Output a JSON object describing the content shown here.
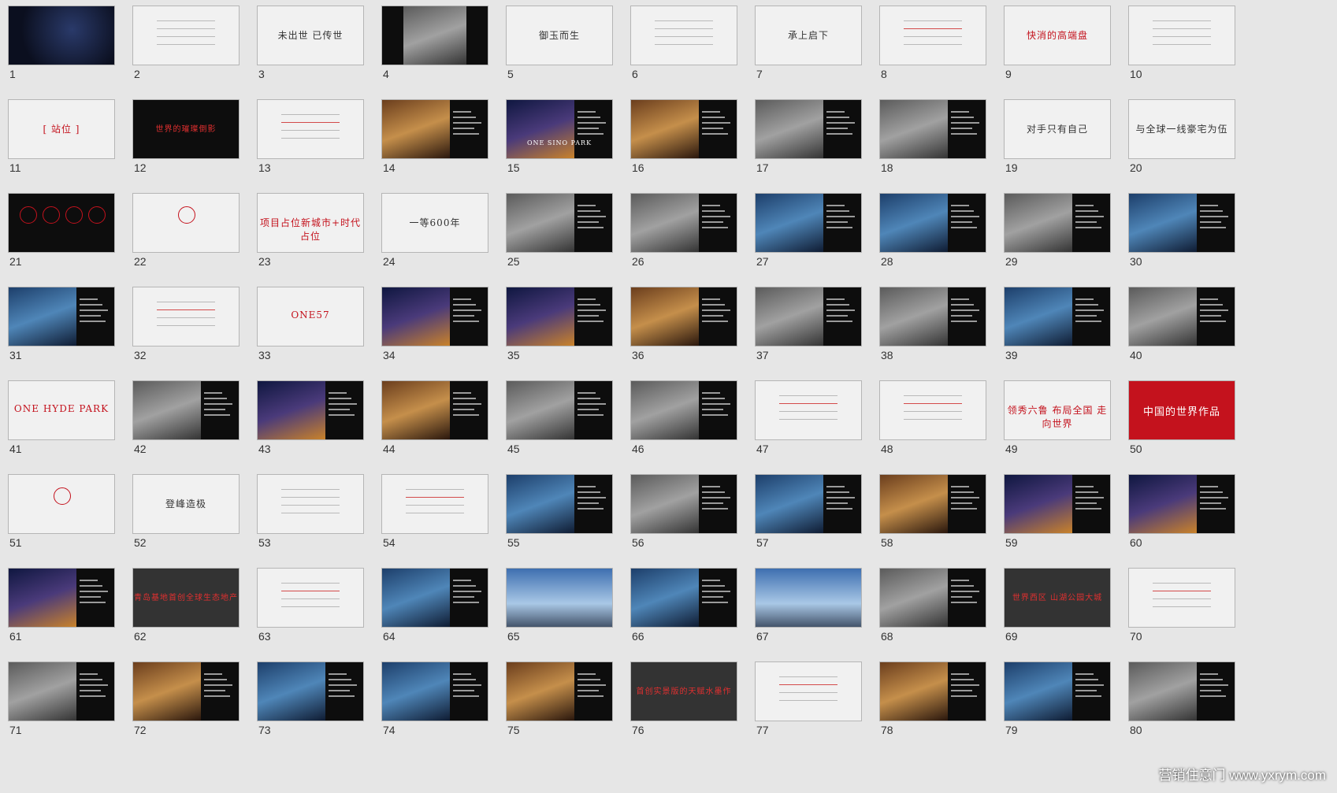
{
  "slides": [
    {
      "n": "1",
      "style": "dark",
      "caption": "",
      "visual": "space"
    },
    {
      "n": "2",
      "style": "light",
      "caption": "",
      "visual": "text"
    },
    {
      "n": "3",
      "style": "light",
      "caption": "未出世 已传世",
      "visual": "title"
    },
    {
      "n": "4",
      "style": "dark",
      "caption": "",
      "visual": "center-photo"
    },
    {
      "n": "5",
      "style": "light",
      "caption": "御玉而生",
      "visual": "title"
    },
    {
      "n": "6",
      "style": "light",
      "caption": "",
      "visual": "text"
    },
    {
      "n": "7",
      "style": "light",
      "caption": "承上启下",
      "visual": "title"
    },
    {
      "n": "8",
      "style": "light",
      "caption": "",
      "visual": "text-accent"
    },
    {
      "n": "9",
      "style": "light",
      "caption": "快消的高端盘",
      "visual": "title-accent"
    },
    {
      "n": "10",
      "style": "light",
      "caption": "",
      "visual": "text"
    },
    {
      "n": "11",
      "style": "light",
      "caption": "[ 站位 ]",
      "visual": "title-accent"
    },
    {
      "n": "12",
      "style": "dark",
      "caption": "世界的璀璨倒影",
      "visual": "title"
    },
    {
      "n": "13",
      "style": "light",
      "caption": "",
      "visual": "text-accent"
    },
    {
      "n": "14",
      "style": "dark",
      "caption": "",
      "visual": "photo-warm"
    },
    {
      "n": "15",
      "style": "dark",
      "caption": "ONE SINO PARK",
      "visual": "photo-night"
    },
    {
      "n": "16",
      "style": "dark",
      "caption": "",
      "visual": "photo-warm"
    },
    {
      "n": "17",
      "style": "dark",
      "caption": "",
      "visual": "photo-gray"
    },
    {
      "n": "18",
      "style": "dark",
      "caption": "",
      "visual": "photo-gray"
    },
    {
      "n": "19",
      "style": "light",
      "caption": "对手只有自己",
      "visual": "title"
    },
    {
      "n": "20",
      "style": "light",
      "caption": "与全球一线豪宅为伍",
      "visual": "title"
    },
    {
      "n": "21",
      "style": "dark",
      "caption": "",
      "visual": "circles"
    },
    {
      "n": "22",
      "style": "light",
      "caption": "",
      "visual": "circle"
    },
    {
      "n": "23",
      "style": "light",
      "caption": "项目占位新城市+时代占位",
      "visual": "title-accent"
    },
    {
      "n": "24",
      "style": "light",
      "caption": "一等600年",
      "visual": "title"
    },
    {
      "n": "25",
      "style": "dark",
      "caption": "",
      "visual": "photo-gray"
    },
    {
      "n": "26",
      "style": "dark",
      "caption": "",
      "visual": "photo-gray"
    },
    {
      "n": "27",
      "style": "dark",
      "caption": "",
      "visual": "photo-blue"
    },
    {
      "n": "28",
      "style": "dark",
      "caption": "",
      "visual": "photo-blue"
    },
    {
      "n": "29",
      "style": "dark",
      "caption": "",
      "visual": "photo-gray"
    },
    {
      "n": "30",
      "style": "dark",
      "caption": "",
      "visual": "photo-blue"
    },
    {
      "n": "31",
      "style": "dark",
      "caption": "",
      "visual": "photo-blue"
    },
    {
      "n": "32",
      "style": "light",
      "caption": "",
      "visual": "text-accent"
    },
    {
      "n": "33",
      "style": "light",
      "caption": "ONE57",
      "visual": "title-accent"
    },
    {
      "n": "34",
      "style": "dark",
      "caption": "",
      "visual": "photo-night"
    },
    {
      "n": "35",
      "style": "dark",
      "caption": "",
      "visual": "photo-night"
    },
    {
      "n": "36",
      "style": "dark",
      "caption": "",
      "visual": "photo-warm"
    },
    {
      "n": "37",
      "style": "dark",
      "caption": "",
      "visual": "photo-gray"
    },
    {
      "n": "38",
      "style": "dark",
      "caption": "",
      "visual": "photo-gray"
    },
    {
      "n": "39",
      "style": "dark",
      "caption": "",
      "visual": "photo-blue"
    },
    {
      "n": "40",
      "style": "dark",
      "caption": "",
      "visual": "photo-gray"
    },
    {
      "n": "41",
      "style": "light",
      "caption": "ONE HYDE PARK",
      "visual": "title-accent"
    },
    {
      "n": "42",
      "style": "dark",
      "caption": "",
      "visual": "photo-gray"
    },
    {
      "n": "43",
      "style": "dark",
      "caption": "",
      "visual": "photo-night"
    },
    {
      "n": "44",
      "style": "dark",
      "caption": "",
      "visual": "photo-warm"
    },
    {
      "n": "45",
      "style": "dark",
      "caption": "",
      "visual": "photo-gray"
    },
    {
      "n": "46",
      "style": "dark",
      "caption": "",
      "visual": "photo-gray"
    },
    {
      "n": "47",
      "style": "light",
      "caption": "",
      "visual": "text-accent"
    },
    {
      "n": "48",
      "style": "light",
      "caption": "",
      "visual": "text-accent"
    },
    {
      "n": "49",
      "style": "light",
      "caption": "领秀六鲁 布局全国 走向世界",
      "visual": "title-accent"
    },
    {
      "n": "50",
      "style": "red",
      "caption": "中国的世界作品",
      "visual": "title"
    },
    {
      "n": "51",
      "style": "light",
      "caption": "",
      "visual": "circle"
    },
    {
      "n": "52",
      "style": "light",
      "caption": "登峰造极",
      "visual": "title"
    },
    {
      "n": "53",
      "style": "light",
      "caption": "",
      "visual": "text"
    },
    {
      "n": "54",
      "style": "light",
      "caption": "",
      "visual": "text-accent"
    },
    {
      "n": "55",
      "style": "dark",
      "caption": "",
      "visual": "photo-blue"
    },
    {
      "n": "56",
      "style": "dark",
      "caption": "",
      "visual": "photo-gray"
    },
    {
      "n": "57",
      "style": "dark",
      "caption": "",
      "visual": "photo-blue"
    },
    {
      "n": "58",
      "style": "dark",
      "caption": "",
      "visual": "photo-warm"
    },
    {
      "n": "59",
      "style": "dark",
      "caption": "",
      "visual": "photo-night"
    },
    {
      "n": "60",
      "style": "dark",
      "caption": "",
      "visual": "photo-night"
    },
    {
      "n": "61",
      "style": "dark",
      "caption": "",
      "visual": "photo-night"
    },
    {
      "n": "62",
      "style": "gray",
      "caption": "青岛基地首创全球生态地产",
      "visual": "title"
    },
    {
      "n": "63",
      "style": "light",
      "caption": "",
      "visual": "text-accent"
    },
    {
      "n": "64",
      "style": "dark",
      "caption": "",
      "visual": "photo-blue"
    },
    {
      "n": "65",
      "style": "dark",
      "caption": "",
      "visual": "photo-sky"
    },
    {
      "n": "66",
      "style": "dark",
      "caption": "",
      "visual": "photo-blue"
    },
    {
      "n": "67",
      "style": "dark",
      "caption": "",
      "visual": "photo-sky"
    },
    {
      "n": "68",
      "style": "dark",
      "caption": "",
      "visual": "photo-gray"
    },
    {
      "n": "69",
      "style": "gray",
      "caption": "世界西区 山湖公园大城",
      "visual": "title"
    },
    {
      "n": "70",
      "style": "light",
      "caption": "",
      "visual": "text-accent"
    },
    {
      "n": "71",
      "style": "dark",
      "caption": "",
      "visual": "photo-gray"
    },
    {
      "n": "72",
      "style": "dark",
      "caption": "",
      "visual": "photo-warm"
    },
    {
      "n": "73",
      "style": "dark",
      "caption": "",
      "visual": "photo-blue"
    },
    {
      "n": "74",
      "style": "dark",
      "caption": "",
      "visual": "photo-blue"
    },
    {
      "n": "75",
      "style": "dark",
      "caption": "",
      "visual": "photo-warm"
    },
    {
      "n": "76",
      "style": "gray",
      "caption": "首创实景版的天赋水墨作",
      "visual": "title"
    },
    {
      "n": "77",
      "style": "light",
      "caption": "",
      "visual": "text-accent"
    },
    {
      "n": "78",
      "style": "dark",
      "caption": "",
      "visual": "photo-warm"
    },
    {
      "n": "79",
      "style": "dark",
      "caption": "",
      "visual": "photo-blue"
    },
    {
      "n": "80",
      "style": "dark",
      "caption": "",
      "visual": "photo-gray"
    }
  ],
  "watermark": "营销住意门 www.yxrym.com"
}
